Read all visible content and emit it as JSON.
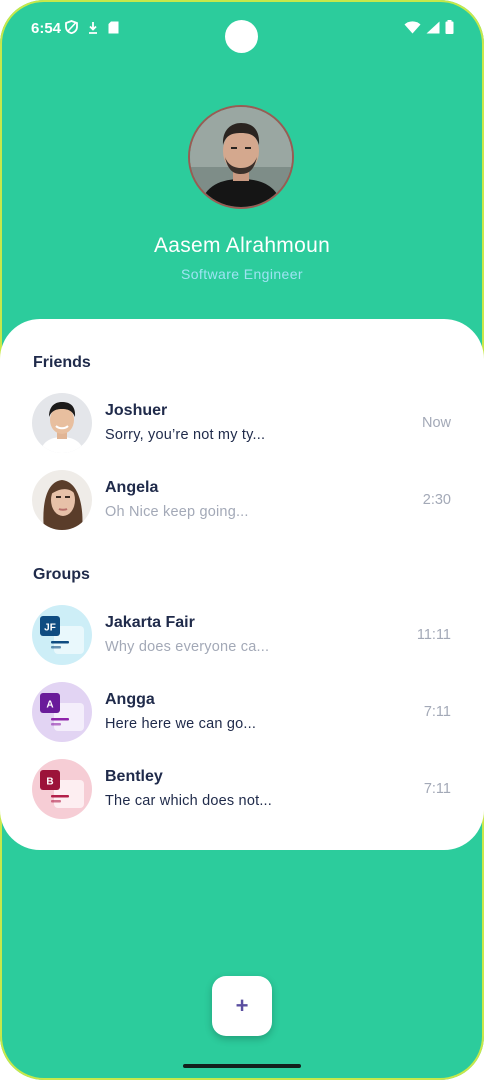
{
  "status": {
    "time": "6:54"
  },
  "profile": {
    "name": "Aasem Alrahmoun",
    "role": "Software Engineer"
  },
  "friends": {
    "title": "Friends",
    "items": [
      {
        "name": "Joshuer",
        "message": "Sorry, you’re not my ty...",
        "time": "Now",
        "unread": true
      },
      {
        "name": "Angela",
        "message": "Oh Nice keep going...",
        "time": "2:30",
        "unread": false
      }
    ]
  },
  "groups": {
    "title": "Groups",
    "items": [
      {
        "name": "Jakarta Fair",
        "message": "Why does everyone ca...",
        "time": "11:11",
        "badge": "JF",
        "color": "#0f4c81",
        "bg": "#cdeef7",
        "unread": false
      },
      {
        "name": "Angga",
        "message": "Here here we can go...",
        "time": "7:11",
        "badge": "A",
        "color": "#6a1b9a",
        "bg": "#e2d4f3",
        "unread": true
      },
      {
        "name": "Bentley",
        "message": "The car which does not...",
        "time": "7:11",
        "badge": "B",
        "color": "#9c1339",
        "bg": "#f6cdd5",
        "unread": true
      }
    ]
  },
  "fab": {
    "label": "+"
  },
  "colors": {
    "background": "#2ccc9c",
    "card": "#ffffff",
    "title_text": "#1f2a4a",
    "muted_text": "#a3a9b7",
    "role_text": "#9ee3f3"
  }
}
